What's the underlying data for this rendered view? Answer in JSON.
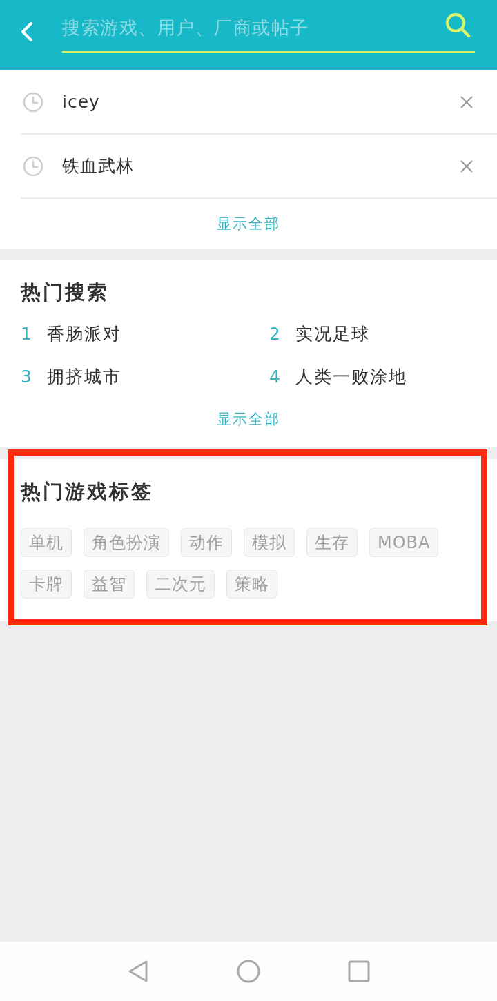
{
  "header": {
    "search": {
      "placeholder": "搜索游戏、用户、厂商或帖子"
    }
  },
  "history": {
    "items": [
      {
        "text": "icey"
      },
      {
        "text": "铁血武林"
      }
    ],
    "show_all": "显示全部"
  },
  "hot_searches": {
    "title": "热门搜索",
    "items": [
      {
        "rank": "1",
        "name": "香肠派对"
      },
      {
        "rank": "2",
        "name": "实况足球"
      },
      {
        "rank": "3",
        "name": "拥挤城市"
      },
      {
        "rank": "4",
        "name": "人类一败涂地"
      }
    ],
    "show_all": "显示全部"
  },
  "hot_tags": {
    "title": "热门游戏标签",
    "highlighted": true,
    "tags": [
      "单机",
      "角色扮演",
      "动作",
      "模拟",
      "生存",
      "MOBA",
      "卡牌",
      "益智",
      "二次元",
      "策略"
    ]
  },
  "nav_bar": {
    "buttons": [
      {
        "kind": "back"
      },
      {
        "kind": "home"
      },
      {
        "kind": "recents"
      }
    ]
  }
}
